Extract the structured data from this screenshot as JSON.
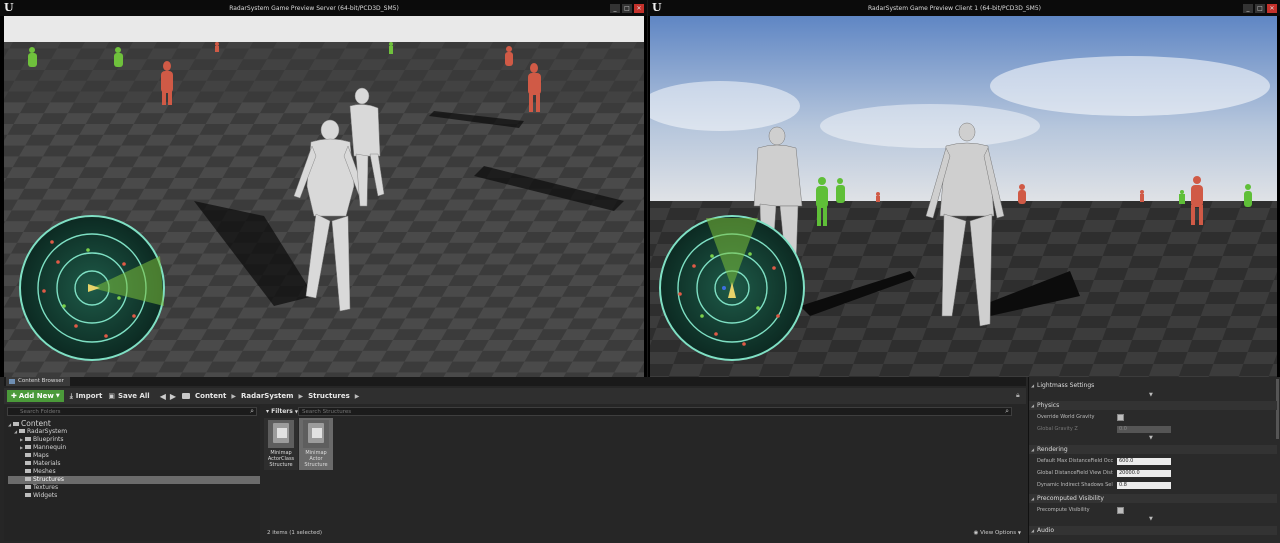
{
  "server_window": {
    "title": "RadarSystem Game Preview Server (64-bit/PCD3D_SM5)",
    "min": "_",
    "max": "□",
    "close": "✕"
  },
  "client_window": {
    "title": "RadarSystem Game Preview Client 1 (64-bit/PCD3D_SM5)",
    "min": "_",
    "max": "□",
    "close": "✕"
  },
  "content_browser": {
    "tab_label": "Content Browser",
    "toolbar": {
      "add_new": "Add New",
      "import": "Import",
      "save_all": "Save All"
    },
    "breadcrumb": [
      "Content",
      "RadarSystem",
      "Structures"
    ],
    "search_folders_placeholder": "Search Folders",
    "search_assets_placeholder": "Search Structures",
    "filters_label": "Filters",
    "folders": {
      "root": "Content",
      "radar": "RadarSystem",
      "children": [
        "Blueprints",
        "Mannequin",
        "Maps",
        "Materials",
        "Meshes",
        "Structures",
        "Textures",
        "Widgets"
      ],
      "selected": "Structures"
    },
    "assets": [
      {
        "name": "Minimap ActorClass Structure",
        "selected": false
      },
      {
        "name": "Minimap Actor Structure",
        "selected": true
      }
    ],
    "status": "2 items (1 selected)",
    "view_options": "View Options"
  },
  "details": {
    "lightmass_settings": "Lightmass Settings",
    "physics": {
      "header": "Physics",
      "override_world_gravity": "Override World Gravity",
      "global_gravity_z": "Global Gravity Z",
      "global_gravity_z_value": "0.0"
    },
    "rendering": {
      "header": "Rendering",
      "default_max_df": "Default Max DistanceField Occ",
      "default_max_df_value": "600.0",
      "global_df_view": "Global DistanceField View Dist",
      "global_df_view_value": "20000.0",
      "dynamic_indirect": "Dynamic Indirect Shadows Sel",
      "dynamic_indirect_value": "0.8"
    },
    "precomputed_visibility": {
      "header": "Precomputed Visibility",
      "precompute_visibility": "Precompute Visibility"
    },
    "audio": {
      "header": "Audio"
    }
  }
}
